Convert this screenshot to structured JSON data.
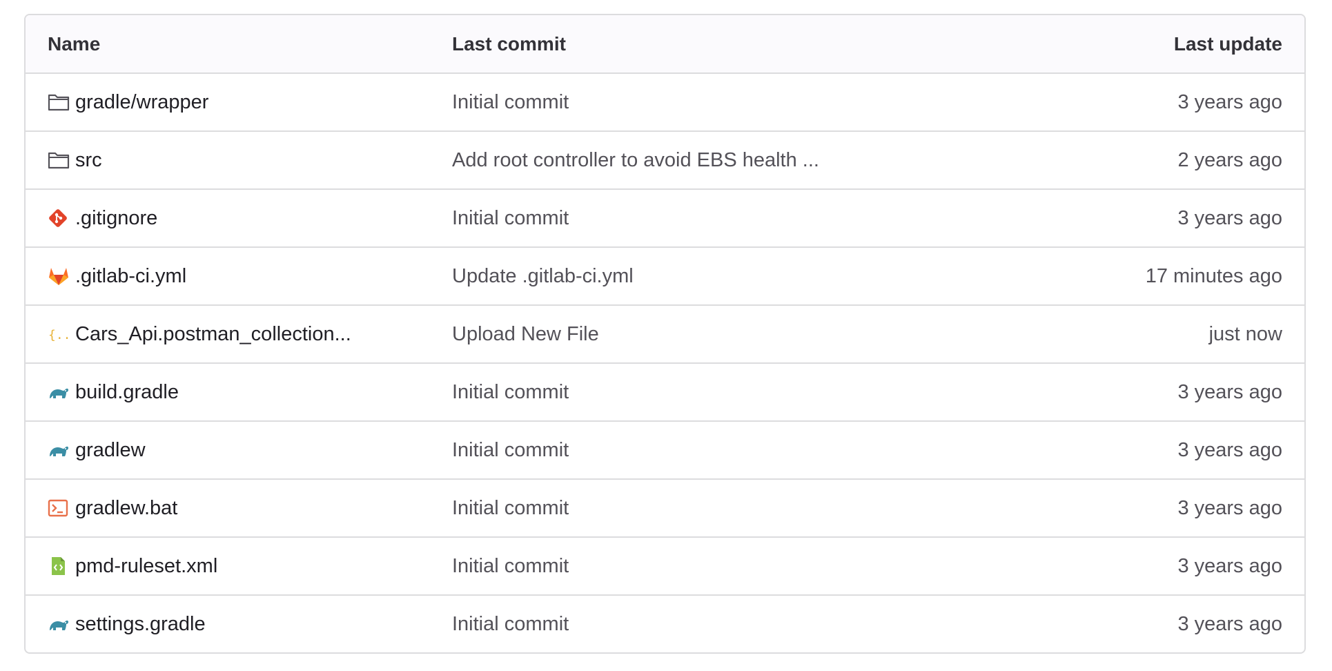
{
  "table": {
    "headers": {
      "name": "Name",
      "last_commit": "Last commit",
      "last_update": "Last update"
    },
    "rows": [
      {
        "name": "gradle/wrapper",
        "icon": "folder-icon",
        "commit": "Initial commit",
        "update": "3 years ago"
      },
      {
        "name": "src",
        "icon": "folder-icon",
        "commit": "Add root controller to avoid EBS health ...",
        "update": "2 years ago"
      },
      {
        "name": ".gitignore",
        "icon": "git-icon",
        "commit": "Initial commit",
        "update": "3 years ago"
      },
      {
        "name": ".gitlab-ci.yml",
        "icon": "gitlab-icon",
        "commit": "Update .gitlab-ci.yml",
        "update": "17 minutes ago"
      },
      {
        "name": "Cars_Api.postman_collection...",
        "icon": "json-icon",
        "commit": "Upload New File",
        "update": "just now"
      },
      {
        "name": "build.gradle",
        "icon": "gradle-icon",
        "commit": "Initial commit",
        "update": "3 years ago"
      },
      {
        "name": "gradlew",
        "icon": "gradle-icon",
        "commit": "Initial commit",
        "update": "3 years ago"
      },
      {
        "name": "gradlew.bat",
        "icon": "terminal-icon",
        "commit": "Initial commit",
        "update": "3 years ago"
      },
      {
        "name": "pmd-ruleset.xml",
        "icon": "xml-file-icon",
        "commit": "Initial commit",
        "update": "3 years ago"
      },
      {
        "name": "settings.gradle",
        "icon": "gradle-icon",
        "commit": "Initial commit",
        "update": "3 years ago"
      }
    ]
  },
  "colors": {
    "border": "#dcdcde",
    "header_bg": "#fbfafd",
    "name_text": "#1f1e24",
    "muted_text": "#535158",
    "git_orange": "#e24329",
    "gitlab_orange": "#fc6d26",
    "json_yellow": "#e8b33a",
    "gradle_teal": "#3b8ea5",
    "terminal_orange": "#e8704a",
    "xml_green": "#8bc34a"
  }
}
